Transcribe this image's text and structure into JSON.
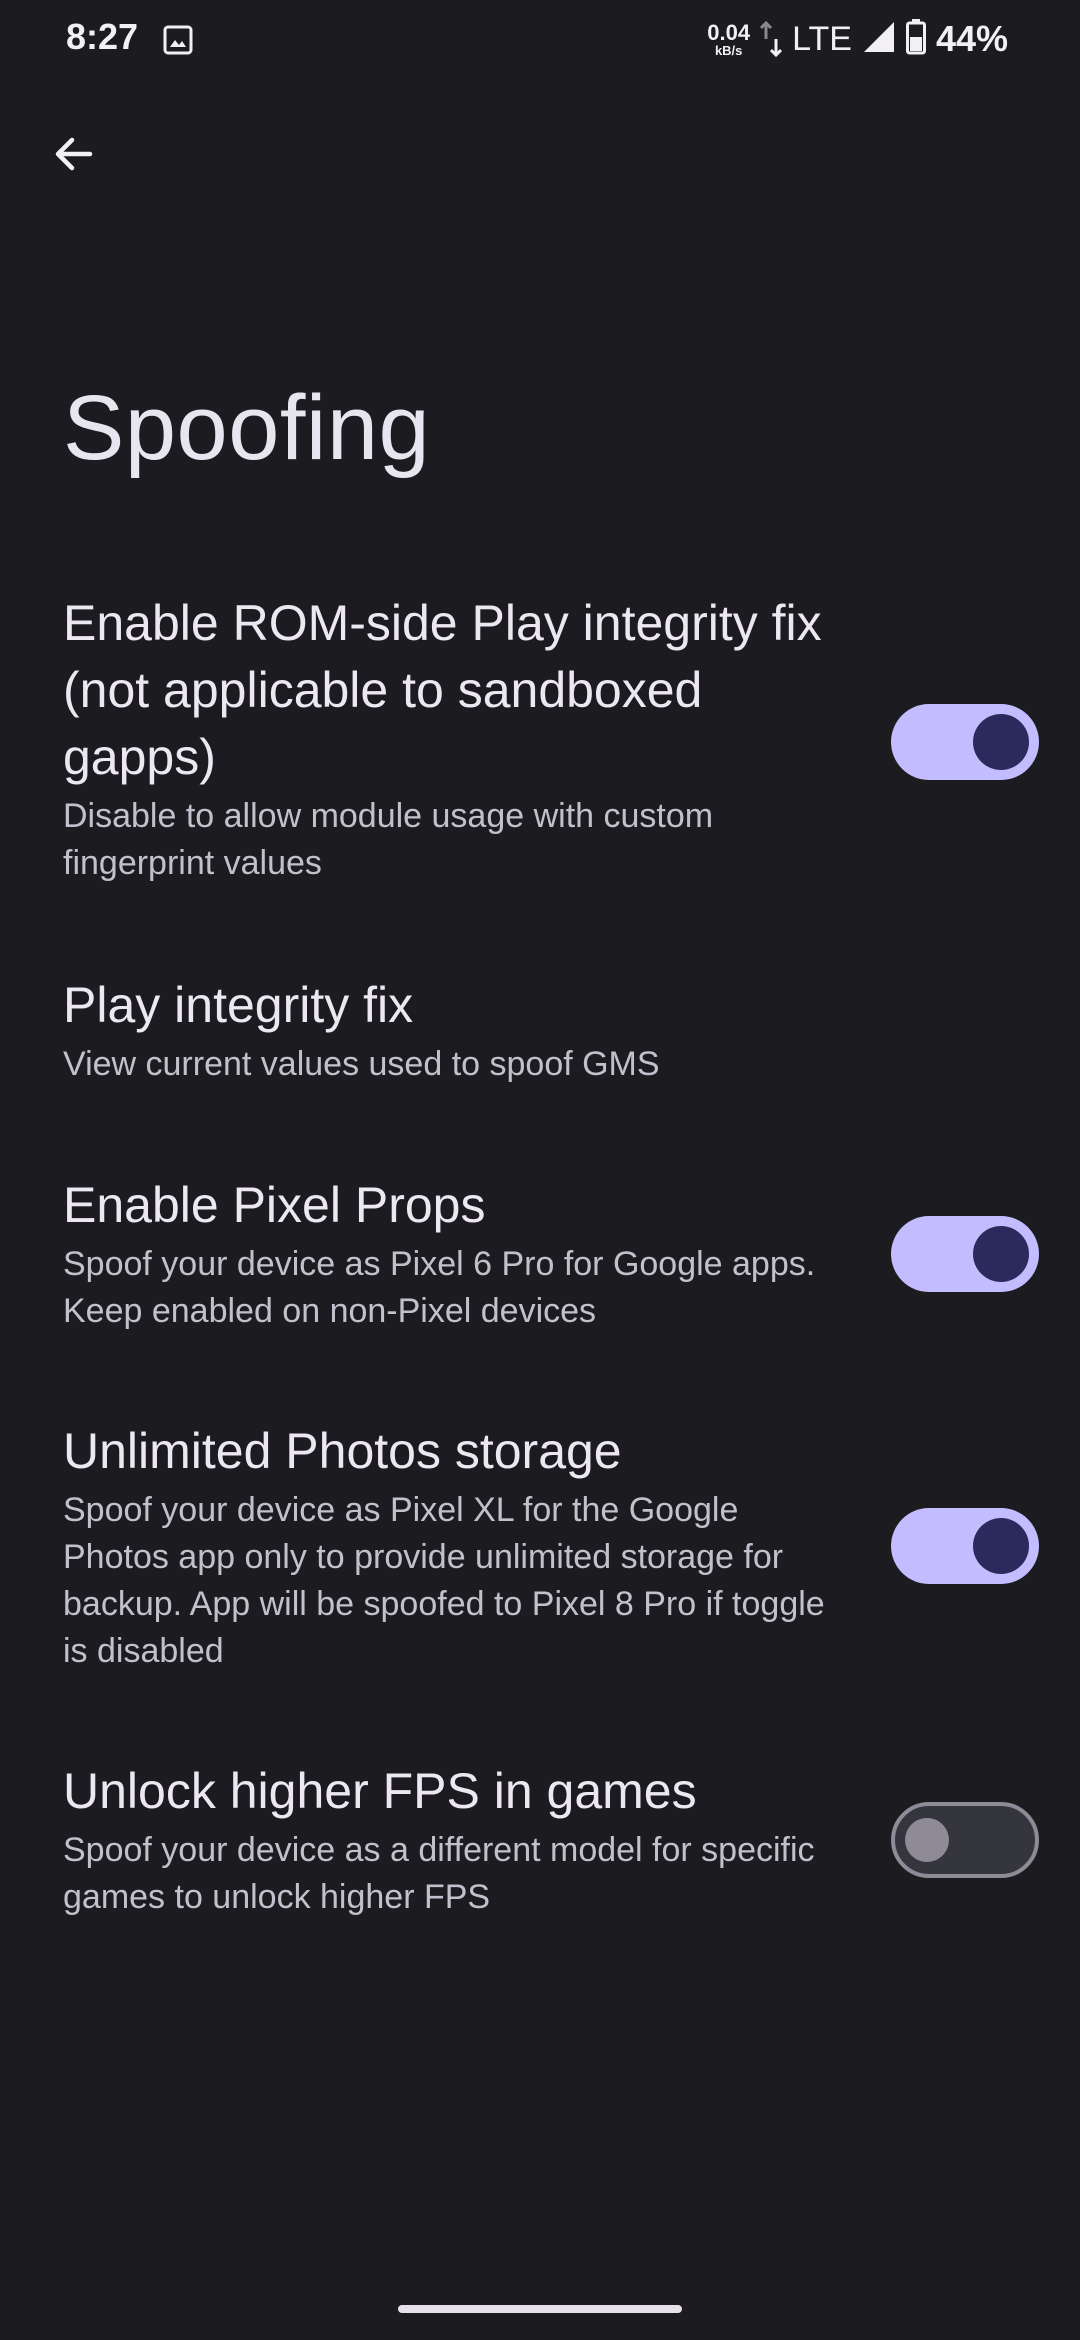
{
  "status_bar": {
    "time": "8:27",
    "net_speed_value": "0.04",
    "net_speed_unit": "kB/s",
    "network": "LTE",
    "battery": "44%"
  },
  "page": {
    "title": "Spoofing"
  },
  "preferences": [
    {
      "title": "Enable ROM-side Play integrity fix (not applicable to sandboxed gapps)",
      "summary": "Disable to allow module usage with custom fingerprint values",
      "toggle": true
    },
    {
      "title": "Play integrity fix",
      "summary": "View current values used to spoof GMS",
      "toggle": null
    },
    {
      "title": "Enable Pixel Props",
      "summary": "Spoof your device as Pixel 6 Pro for Google apps. Keep enabled on non-Pixel devices",
      "toggle": true
    },
    {
      "title": "Unlimited Photos storage",
      "summary": "Spoof your device as Pixel XL for the Google Photos app only to provide unlimited storage for backup. App will be spoofed to Pixel 8 Pro if toggle is disabled",
      "toggle": true
    },
    {
      "title": "Unlock higher FPS in games",
      "summary": "Spoof your device as a different model for specific games to unlock higher FPS",
      "toggle": false
    }
  ],
  "colors": {
    "background": "#1b1b20",
    "switch_on_track": "#c3bdff",
    "switch_on_thumb": "#2a2a5c",
    "switch_off_outline": "#8e8b96"
  },
  "icons": {
    "back": "arrow-back-icon",
    "gallery": "image-icon",
    "signal": "cell-signal-icon",
    "battery": "battery-icon"
  }
}
